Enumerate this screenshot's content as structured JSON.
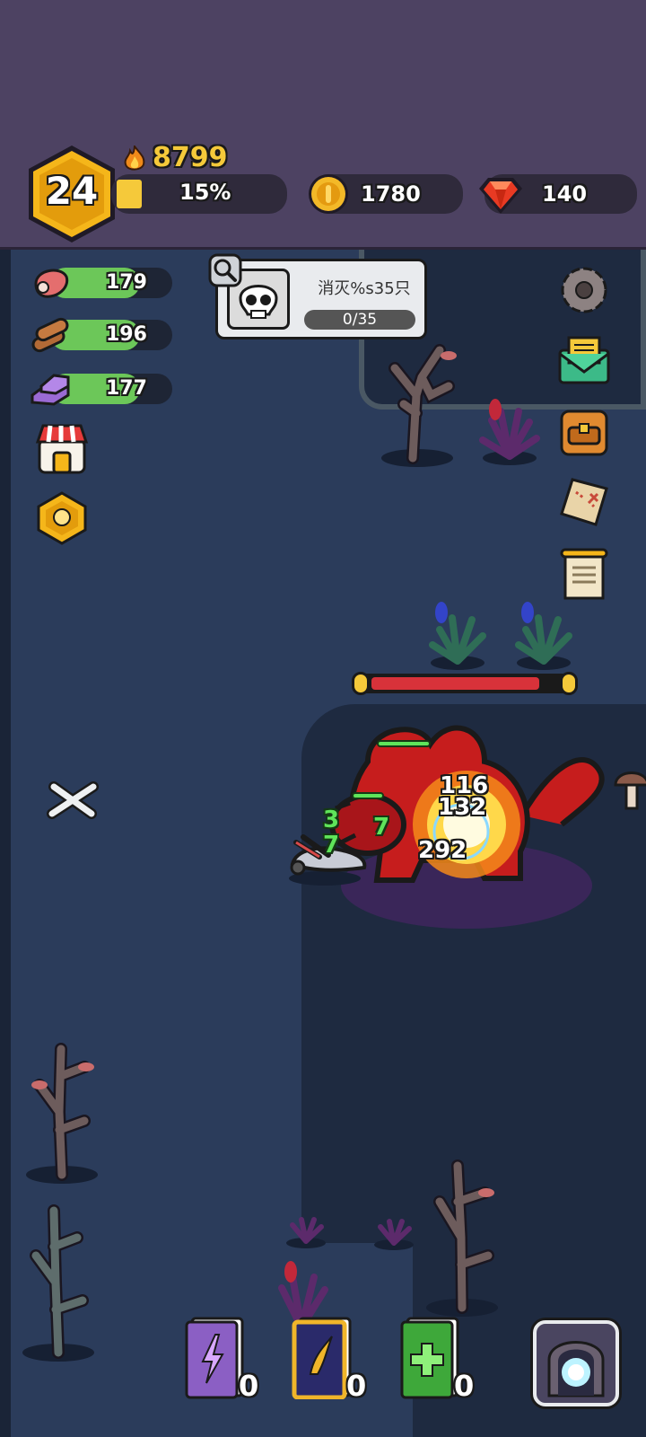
{
  "player": {
    "level": "24",
    "power": "8799",
    "xp_percent_label": "15%",
    "xp_fraction": 0.15
  },
  "currency": {
    "gold": "1780",
    "gems": "140"
  },
  "resources": [
    {
      "name": "meat-icon",
      "value": "179"
    },
    {
      "name": "wood-icon",
      "value": "196"
    },
    {
      "name": "ore-icon",
      "value": "177"
    }
  ],
  "quest": {
    "title": "消灭%s35只",
    "progress_label": "0/35",
    "progress_fraction": 0
  },
  "boss": {
    "health_fraction": 0.9
  },
  "combat_text": {
    "dmg_1": "116",
    "dmg_2": "132",
    "dmg_3": "292",
    "heal_1": "3",
    "heal_2": "7",
    "heal_3": "7"
  },
  "skill_books": [
    {
      "name": "lightning-book",
      "count": "0",
      "color": "#8b5fc4"
    },
    {
      "name": "wind-book",
      "count": "0",
      "color": "#f0b52a"
    },
    {
      "name": "heal-book",
      "count": "0",
      "color": "#3ea83a"
    }
  ],
  "colors": {
    "hud_bg": "#4d4262",
    "field_bg": "#2b3c5b",
    "level_hex": "#f5b61a",
    "power_text": "#f5c93a",
    "boss_red": "#c61d1d"
  }
}
